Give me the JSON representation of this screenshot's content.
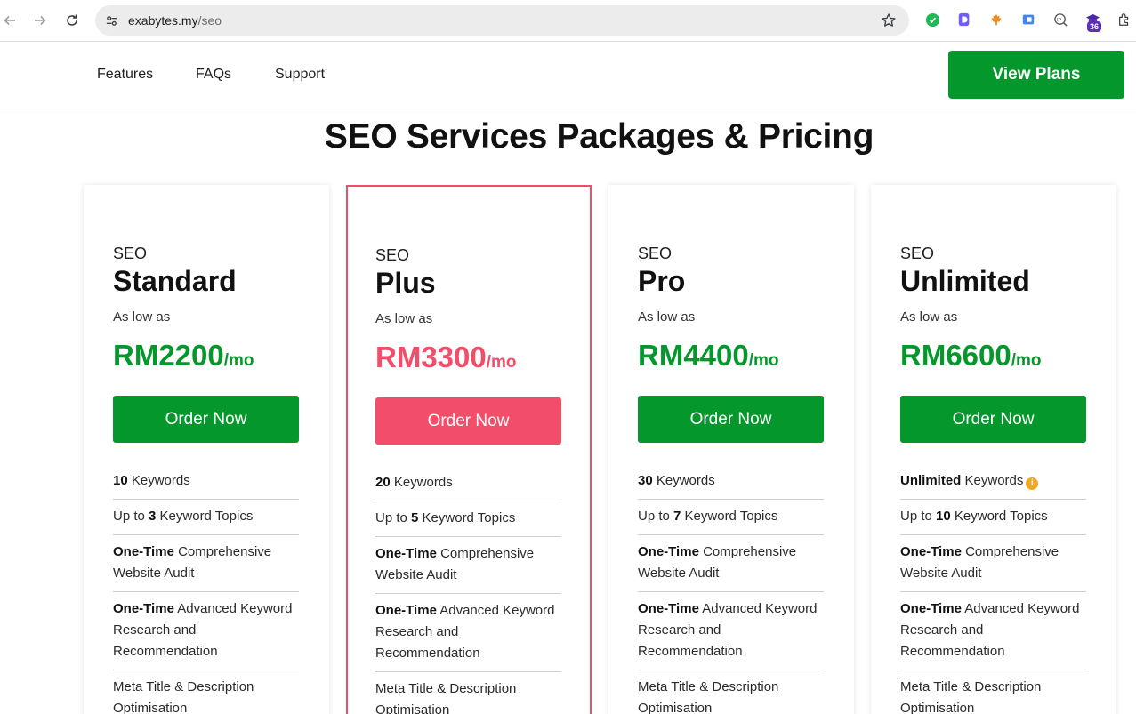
{
  "browser": {
    "url_host": "exabytes.my",
    "url_path": "/seo",
    "extension_badge": "36"
  },
  "nav": {
    "features": "Features",
    "faqs": "FAQs",
    "support": "Support",
    "cta": "View Plans"
  },
  "title": "SEO Services Packages & Pricing",
  "colors": {
    "brand_green": "#04982c",
    "featured_pink": "#f24e6a"
  },
  "plans": [
    {
      "prefix": "SEO",
      "name": "Standard",
      "as_low_as": "As low as",
      "price": "RM2200",
      "per": "/mo",
      "order": "Order Now",
      "keywords_count": "10",
      "keywords_label": " Keywords",
      "topics_pre": "Up to ",
      "topics_count": "3",
      "topics_label": " Keyword Topics",
      "audit_bold": "One-Time",
      "audit_text": " Comprehensive Website Audit",
      "research_bold": "One-Time",
      "research_text": " Advanced Keyword Research and Recommendation",
      "meta": "Meta Title & Description Optimisation"
    },
    {
      "prefix": "SEO",
      "name": "Plus",
      "as_low_as": "As low as",
      "price": "RM3300",
      "per": "/mo",
      "order": "Order Now",
      "keywords_count": "20",
      "keywords_label": " Keywords",
      "topics_pre": "Up to ",
      "topics_count": "5",
      "topics_label": " Keyword Topics",
      "audit_bold": "One-Time",
      "audit_text": " Comprehensive Website Audit",
      "research_bold": "One-Time",
      "research_text": " Advanced Keyword Research and Recommendation",
      "meta": "Meta Title & Description Optimisation"
    },
    {
      "prefix": "SEO",
      "name": "Pro",
      "as_low_as": "As low as",
      "price": "RM4400",
      "per": "/mo",
      "order": "Order Now",
      "keywords_count": "30",
      "keywords_label": " Keywords",
      "topics_pre": "Up to ",
      "topics_count": "7",
      "topics_label": " Keyword Topics",
      "audit_bold": "One-Time",
      "audit_text": " Comprehensive Website Audit",
      "research_bold": "One-Time",
      "research_text": " Advanced Keyword Research and Recommendation",
      "meta": "Meta Title & Description Optimisation"
    },
    {
      "prefix": "SEO",
      "name": "Unlimited",
      "as_low_as": "As low as",
      "price": "RM6600",
      "per": "/mo",
      "order": "Order Now",
      "keywords_count": "Unlimited",
      "keywords_label": " Keywords",
      "topics_pre": "Up to ",
      "topics_count": "10",
      "topics_label": " Keyword Topics",
      "audit_bold": "One-Time",
      "audit_text": " Comprehensive Website Audit",
      "research_bold": "One-Time",
      "research_text": " Advanced Keyword Research and Recommendation",
      "meta": "Meta Title & Description Optimisation"
    }
  ]
}
